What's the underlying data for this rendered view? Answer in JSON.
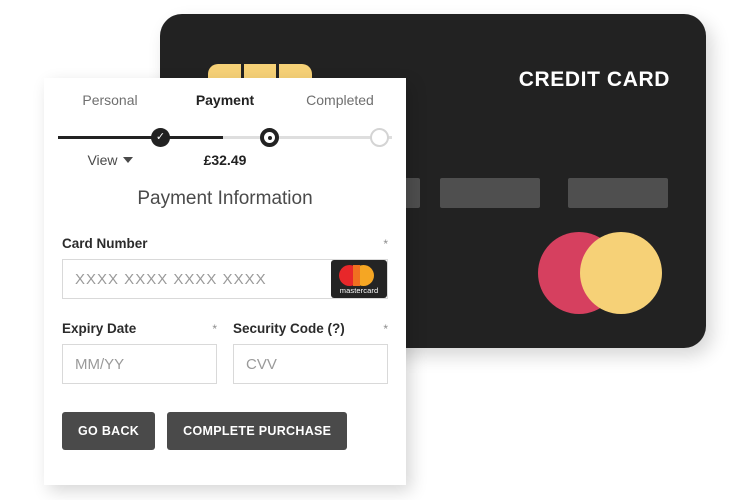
{
  "card_preview": {
    "brand_label": "CREDIT CARD",
    "chip_icon": "card-chip-icon",
    "brand_mark_icon": "mastercard-circles-icon",
    "colors": {
      "card_background": "#222222",
      "chip": "#f6d177",
      "bar": "#4f4f4f",
      "mastercard_red": "#d6405f",
      "mastercard_yellow": "#f6d177"
    }
  },
  "steps": {
    "items": [
      {
        "label": "Personal",
        "sub": "View",
        "state": "complete",
        "dot_icon": "check-circle-icon"
      },
      {
        "label": "Payment",
        "sub": "£32.49",
        "state": "current",
        "dot_icon": "radio-selected-icon"
      },
      {
        "label": "Completed",
        "sub": "",
        "state": "upcoming",
        "dot_icon": "circle-empty-icon"
      }
    ]
  },
  "form": {
    "heading": "Payment Information",
    "card_number": {
      "label": "Card Number",
      "required_mark": "*",
      "placeholder": "XXXX XXXX XXXX XXXX",
      "value": "",
      "brand_badge": "mastercard"
    },
    "expiry": {
      "label": "Expiry Date",
      "required_mark": "*",
      "placeholder": "MM/YY",
      "value": ""
    },
    "security_code": {
      "label": "Security Code (?)",
      "required_mark": "*",
      "placeholder": "CVV",
      "value": ""
    },
    "buttons": {
      "back": "GO BACK",
      "submit": "COMPLETE PURCHASE"
    }
  }
}
